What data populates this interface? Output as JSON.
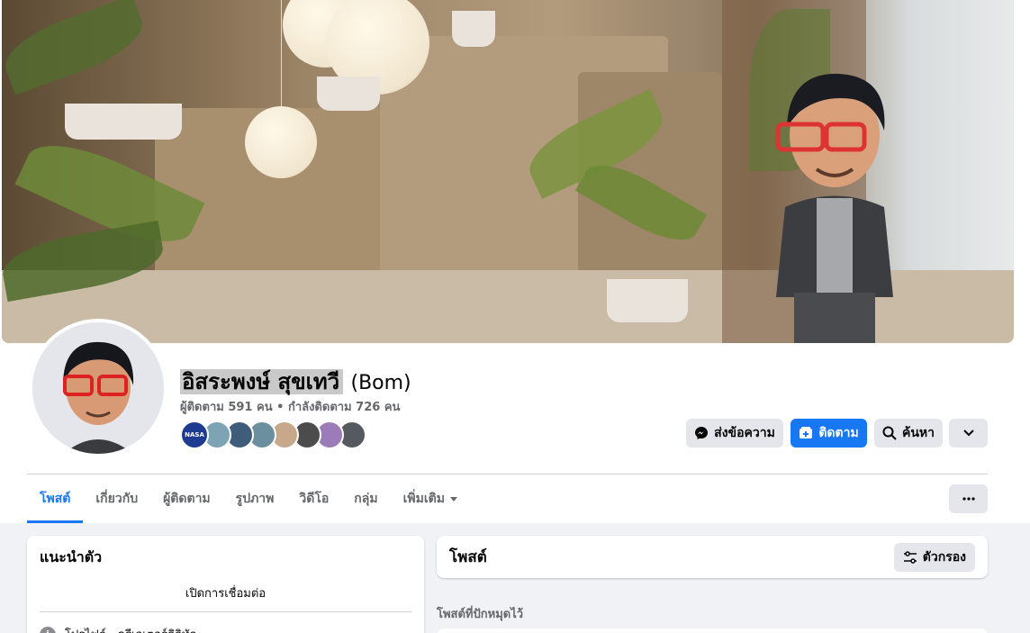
{
  "profile": {
    "name": "อิสระพงษ์ สุขเทวี",
    "alternate_name": "(Bom)",
    "stats": "ผู้ติดตาม 591 คน • กำลังติดตาม 726 คน",
    "friend_avatars": [
      {
        "label": "NASA",
        "color": "#1d3c8f"
      },
      {
        "label": "",
        "color": "#7da3b5"
      },
      {
        "label": "",
        "color": "#3f5c7a"
      },
      {
        "label": "",
        "color": "#6b8f9e"
      },
      {
        "label": "",
        "color": "#c8a88a"
      },
      {
        "label": "",
        "color": "#4c4c4c"
      },
      {
        "label": "",
        "color": "#9b7bb8"
      },
      {
        "label": "",
        "color": "#555a60"
      }
    ]
  },
  "actions": {
    "message_label": "ส่งข้อความ",
    "follow_label": "ติดตาม",
    "search_label": "ค้นหา"
  },
  "tabs": {
    "items": [
      "โพสต์",
      "เกี่ยวกับ",
      "ผู้ติดตาม",
      "รูปภาพ",
      "วิดีโอ",
      "กลุ่ม",
      "เพิ่มเติม"
    ],
    "active": "โพสต์"
  },
  "intro": {
    "title": "แนะนำตัว",
    "connection_link": "เปิดการเชื่อมต่อ",
    "profile_row": "โปรไฟล์ · ครีเอเตอร์ดิจิทัล"
  },
  "posts": {
    "title": "โพสต์",
    "filter_label": "ตัวกรอง",
    "pinned_label": "โพสต์ที่ปักหมุดไว้"
  },
  "colors": {
    "accent": "#1877f2",
    "page_bg": "#f0f2f5",
    "button_gray": "#e4e6eb",
    "secondary_text": "#65676b"
  },
  "icons": [
    "messenger-icon",
    "follow-icon",
    "search-icon",
    "chevron-down-icon",
    "more-horizontal-icon",
    "filter-icon",
    "info-icon",
    "dropdown-caret-icon"
  ]
}
